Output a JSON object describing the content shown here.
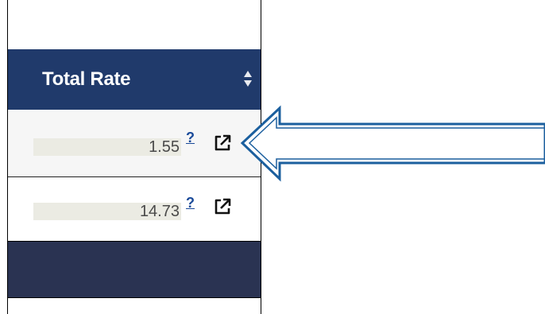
{
  "table": {
    "column_header": "Total Rate",
    "rows": [
      {
        "value": "1.55",
        "help": "?"
      },
      {
        "value": "14.73",
        "help": "?"
      }
    ]
  },
  "icons": {
    "sort": "sort-icon",
    "external_link": "external-link-icon",
    "arrow": "arrow-left-icon"
  },
  "colors": {
    "header_bg": "#203a6b",
    "footer_bg": "#2a3352",
    "field_bg": "#ebebe3",
    "arrow_stroke": "#1b5f9e"
  }
}
